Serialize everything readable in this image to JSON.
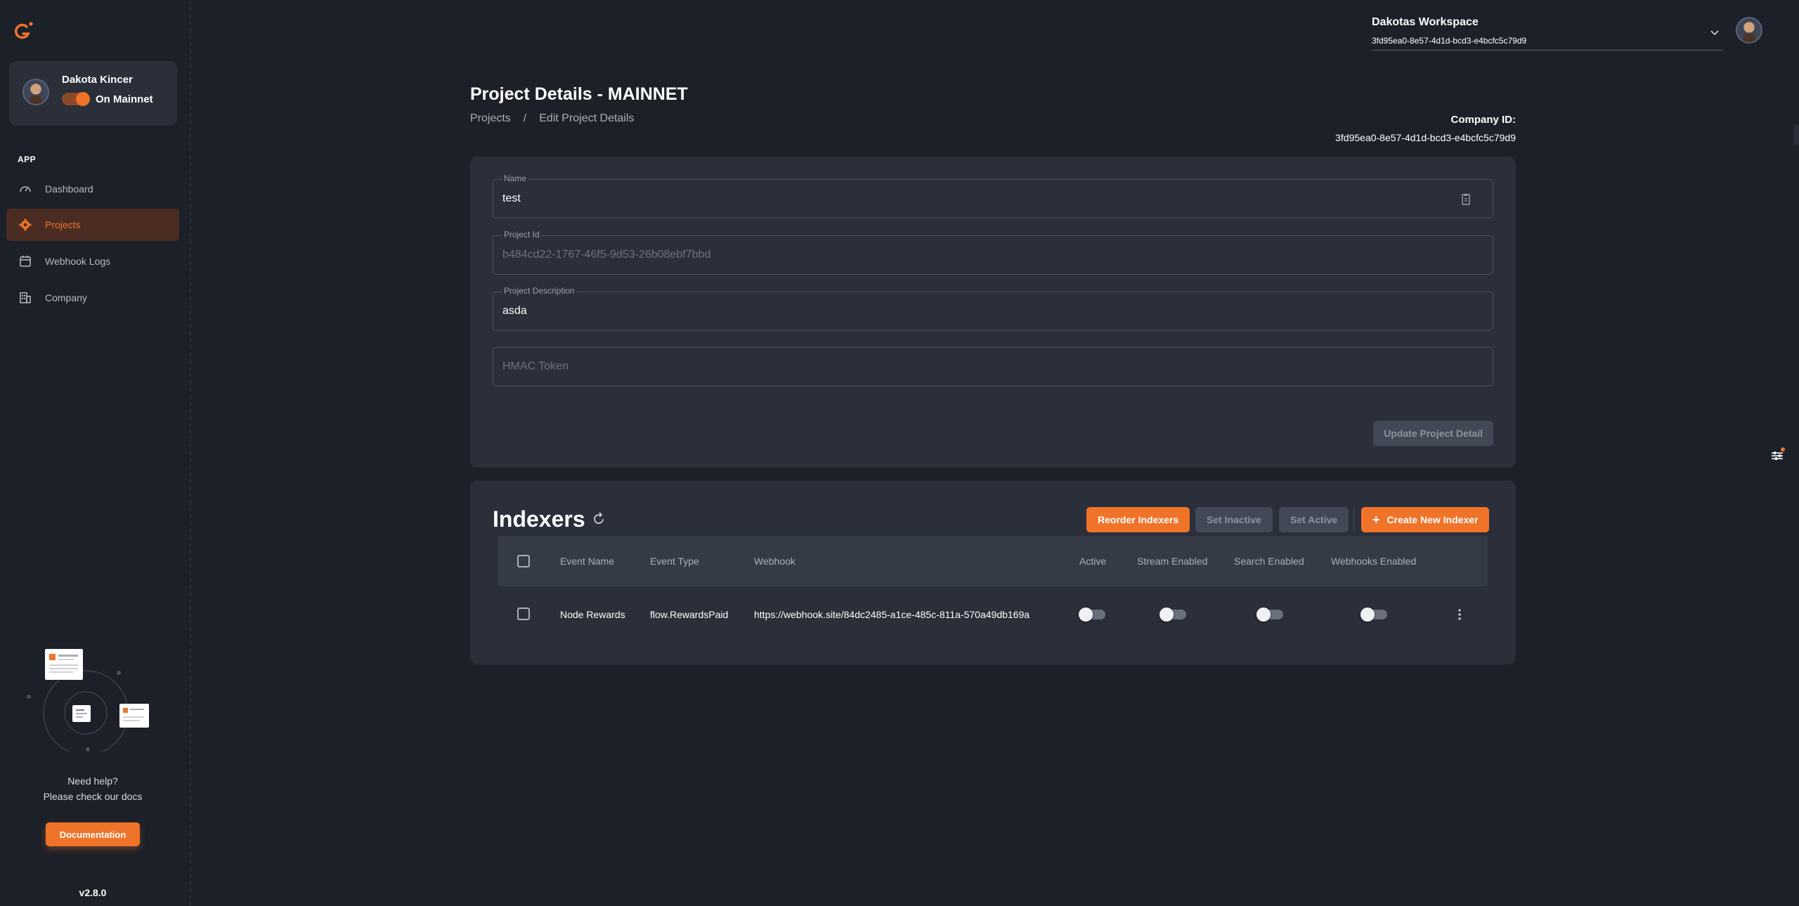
{
  "app": {
    "version": "v2.8.0"
  },
  "user": {
    "name": "Dakota Kincer",
    "network_label": "On Mainnet"
  },
  "sidebar": {
    "section": "APP",
    "items": [
      {
        "label": "Dashboard",
        "icon": "gauge-icon",
        "active": false
      },
      {
        "label": "Projects",
        "icon": "gear-icon",
        "active": true
      },
      {
        "label": "Webhook Logs",
        "icon": "calendar-icon",
        "active": false
      },
      {
        "label": "Company",
        "icon": "building-icon",
        "active": false
      }
    ],
    "help_line1": "Need help?",
    "help_line2": "Please check our docs",
    "docs_button": "Documentation"
  },
  "workspace": {
    "name": "Dakotas Workspace",
    "id": "3fd95ea0-8e57-4d1d-bcd3-e4bcfc5c79d9"
  },
  "header": {
    "title": "Project Details - MAINNET",
    "breadcrumb": [
      "Projects",
      "/",
      "Edit Project Details"
    ],
    "company_label": "Company ID:",
    "company_id": "3fd95ea0-8e57-4d1d-bcd3-e4bcfc5c79d9"
  },
  "form": {
    "name": {
      "label": "Name",
      "value": "test"
    },
    "project_id": {
      "label": "Project Id",
      "value": "b484cd22-1767-46f5-9d53-26b08ebf7bbd"
    },
    "description": {
      "label": "Project Description",
      "value": "asda"
    },
    "hmac": {
      "placeholder": "HMAC Token"
    },
    "update_button": "Update Project Detail"
  },
  "indexers": {
    "title": "Indexers",
    "buttons": {
      "reorder": "Reorder Indexers",
      "set_inactive": "Set Inactive",
      "set_active": "Set Active",
      "create": "Create New Indexer"
    },
    "columns": [
      "Event Name",
      "Event Type",
      "Webhook",
      "Active",
      "Stream Enabled",
      "Search Enabled",
      "Webhooks Enabled"
    ],
    "rows": [
      {
        "event_name": "Node Rewards",
        "event_type": "flow.RewardsPaid",
        "webhook": "https://webhook.site/84dc2485-a1ce-485c-811a-570a49db169a",
        "active": false,
        "stream_enabled": false,
        "search_enabled": false,
        "webhooks_enabled": false
      }
    ]
  },
  "colors": {
    "accent": "#f0732a",
    "background": "#1c2029",
    "card": "#2a2f3a"
  }
}
